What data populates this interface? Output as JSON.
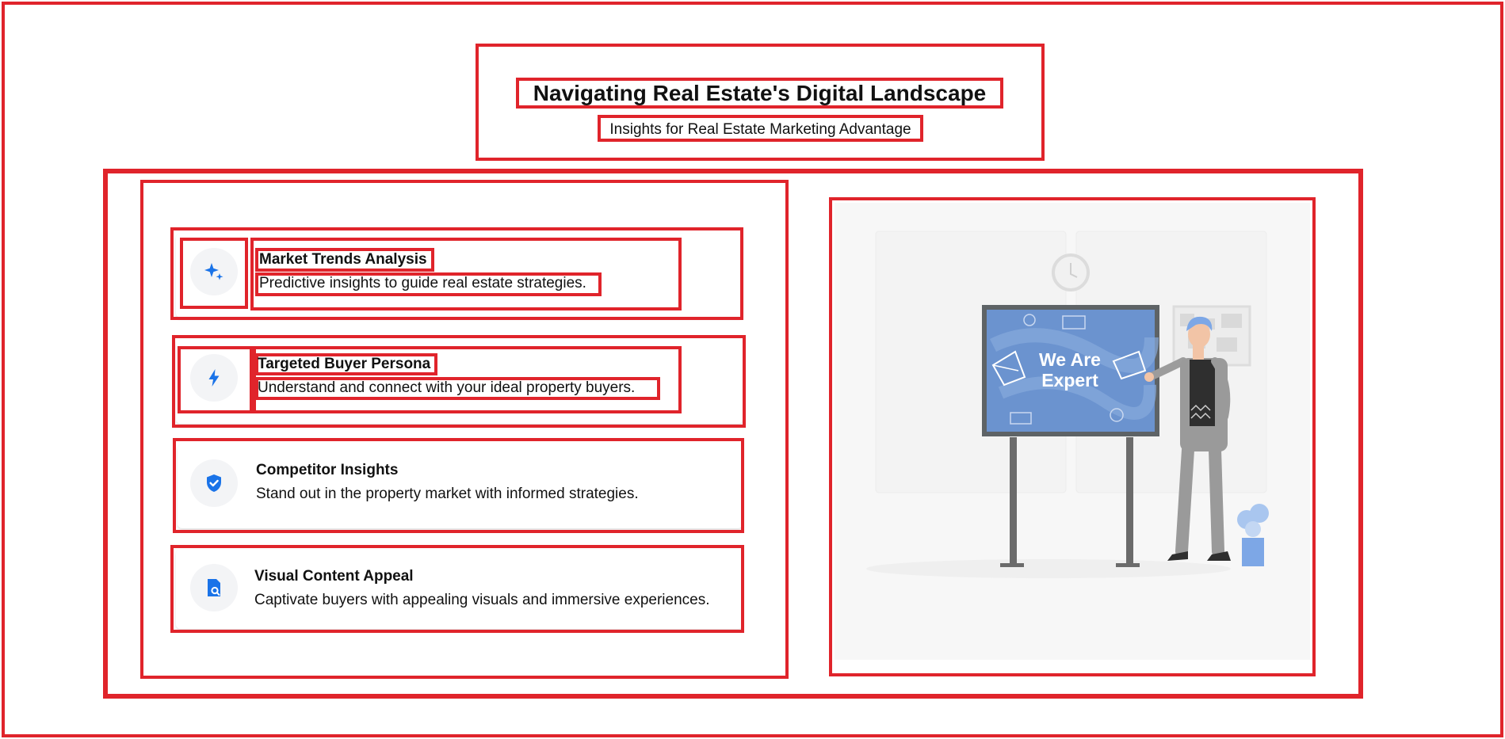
{
  "header": {
    "title": "Navigating Real Estate's Digital Landscape",
    "subtitle": "Insights for Real Estate Marketing Advantage"
  },
  "features": [
    {
      "icon": "sparkle-icon",
      "title": "Market Trends Analysis",
      "description": "Predictive insights to guide real estate strategies."
    },
    {
      "icon": "lightning-icon",
      "title": "Targeted Buyer Persona",
      "description": "Understand and connect with your ideal property buyers."
    },
    {
      "icon": "shield-check-icon",
      "title": "Competitor Insights",
      "description": "Stand out in the property market with informed strategies."
    },
    {
      "icon": "document-search-icon",
      "title": "Visual Content Appeal",
      "description": "Captivate buyers with appealing visuals and immersive experiences."
    }
  ],
  "illustration": {
    "board_text_line1": "We Are",
    "board_text_line2": "Expert"
  },
  "colors": {
    "accent": "#1a73e8",
    "annotation": "#e0242b",
    "board": "#6b93cf"
  }
}
